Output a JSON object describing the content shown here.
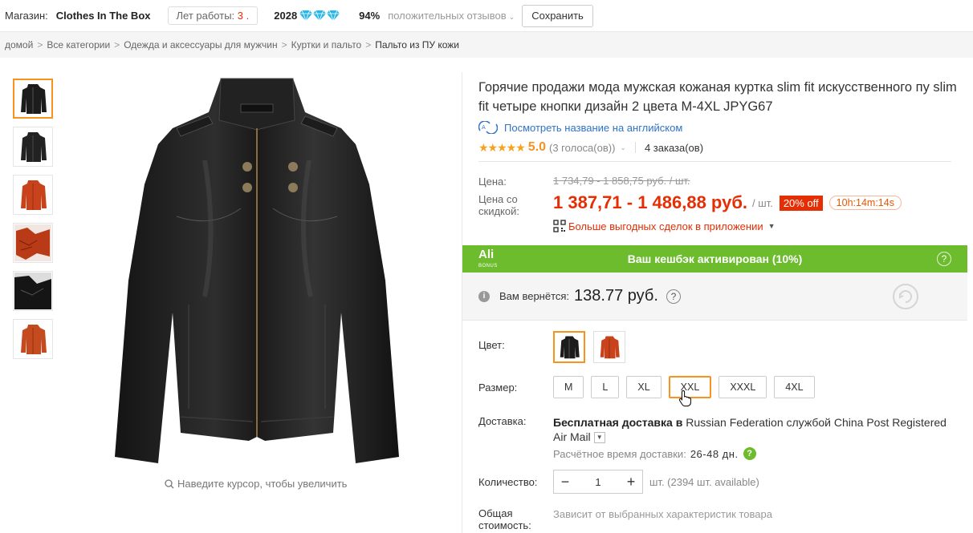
{
  "store": {
    "label": "Магазин:",
    "name": "Clothes In The Box",
    "years_label": "Лет работы:",
    "years_value": "3 .",
    "score": "2028",
    "positive_pct": "94%",
    "feedback_label": "положительных отзывов",
    "save_label": "Сохранить"
  },
  "breadcrumb": [
    "домой",
    "Все категории",
    "Одежда и аксессуары для мужчин",
    "Куртки и пальто",
    "Пальто из ПУ кожи"
  ],
  "gallery": {
    "zoom_hint": "Наведите курсор, чтобы увеличить"
  },
  "product": {
    "title": "Горячие продажи мода мужская кожаная куртка slim fit искусственного пу slim fit четыре кнопки дизайн 2 цвета M-4XL JPYG67",
    "translate_link": "Посмотреть название на английском",
    "stars": "★★★★★",
    "rating": "5.0",
    "votes": "(3 голоса(ов))",
    "orders": "4 заказа(ов)"
  },
  "price": {
    "price_label": "Цена:",
    "old_price": "1 734,79 - 1 858,75 руб. / шт.",
    "discount_label": "Цена со скидкой:",
    "new_price": "1 387,71 - 1 486,88 руб.",
    "unit": "/ шт.",
    "off_badge": "20% off",
    "timer": "10h:14m:14s",
    "app_deals": "Больше выгодных сделок в приложении"
  },
  "cashback": {
    "logo": "Ali",
    "logo_sub": "BONUS",
    "banner": "Ваш кешбэк активирован (10%)",
    "refund_label": "Вам вернётся:",
    "refund_amount": "138.77 руб.",
    "accent": "#6cbc2d"
  },
  "options": {
    "color_label": "Цвет:",
    "size_label": "Размер:",
    "sizes": [
      "M",
      "L",
      "XL",
      "XXL",
      "XXXL",
      "4XL"
    ],
    "selected_size": "XXL"
  },
  "delivery": {
    "label": "Доставка:",
    "free_text": "Бесплатная доставка в",
    "destination": "Russian Federation службой China Post Registered Air Mail",
    "eta_label": "Расчётное время доставки:",
    "eta_days": "26-48 дн."
  },
  "quantity": {
    "label": "Количество:",
    "value": "1",
    "stock": "шт. (2394 шт. available)"
  },
  "total": {
    "label": "Общая стоимость:",
    "value": "Зависит от выбранных характеристик товара"
  },
  "colors": {
    "price_red": "#e62e04",
    "orange_accent": "#f7931e",
    "link_blue": "#2e73c8"
  }
}
